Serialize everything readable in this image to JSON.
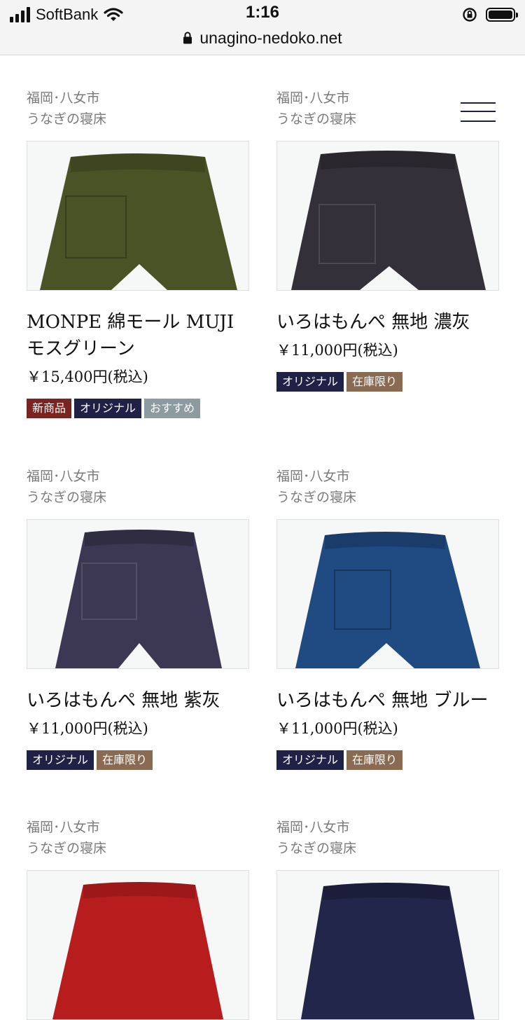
{
  "status_bar": {
    "carrier": "SoftBank",
    "time": "1:16"
  },
  "browser": {
    "url": "unagino-nedoko.net"
  },
  "colors": {
    "new": "#7a2320",
    "original": "#1f2147",
    "recommended": "#8d9b9e",
    "limited": "#8a6a51"
  },
  "products": [
    {
      "maker_line1": "福岡･八女市",
      "maker_line2": "うなぎの寝床",
      "title": "MONPE 綿モール MUJI モスグリーン",
      "price": "￥15,400円(税込)",
      "pants_color": "#4a5325",
      "tags": [
        "新商品",
        "オリジナル",
        "おすすめ"
      ]
    },
    {
      "maker_line1": "福岡･八女市",
      "maker_line2": "うなぎの寝床",
      "title": "いろはもんぺ 無地 濃灰",
      "price": "￥11,000円(税込)",
      "pants_color": "#34303a",
      "tags": [
        "オリジナル",
        "在庫限り"
      ]
    },
    {
      "maker_line1": "福岡･八女市",
      "maker_line2": "うなぎの寝床",
      "title": "いろはもんぺ 無地 紫灰",
      "price": "￥11,000円(税込)",
      "pants_color": "#3c3752",
      "tags": [
        "オリジナル",
        "在庫限り"
      ]
    },
    {
      "maker_line1": "福岡･八女市",
      "maker_line2": "うなぎの寝床",
      "title": "いろはもんぺ 無地 ブルー",
      "price": "￥11,000円(税込)",
      "pants_color": "#1f4a82",
      "tags": [
        "オリジナル",
        "在庫限り"
      ]
    },
    {
      "maker_line1": "福岡･八女市",
      "maker_line2": "うなぎの寝床",
      "pants_color": "#b81d1e"
    },
    {
      "maker_line1": "福岡･八女市",
      "maker_line2": "うなぎの寝床",
      "pants_color": "#22264a"
    }
  ]
}
